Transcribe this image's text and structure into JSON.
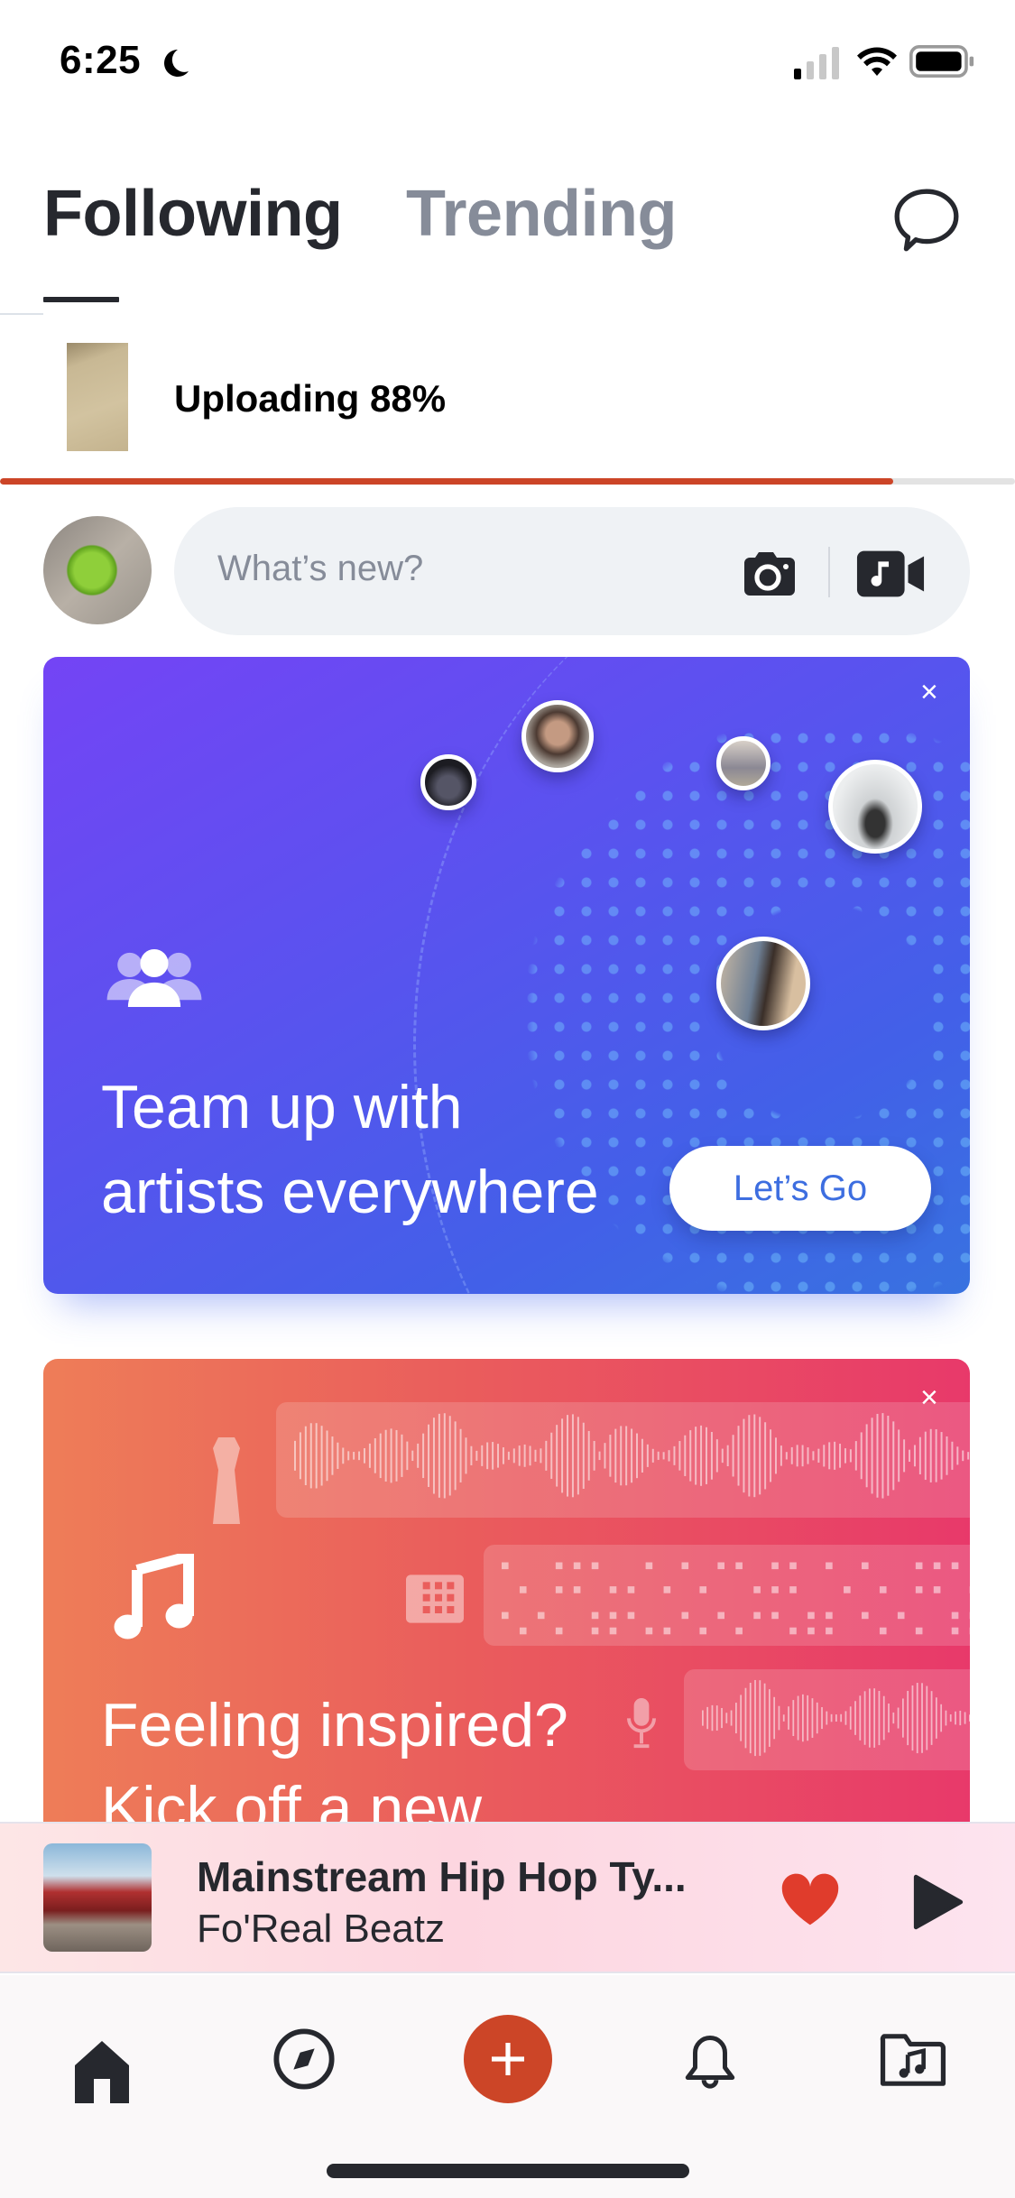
{
  "status_bar": {
    "time": "6:25",
    "focus_icon": "moon-icon",
    "signal_bars_active": 1,
    "signal_bars_total": 4,
    "wifi": "wifi-icon",
    "battery": "battery-icon"
  },
  "header": {
    "tabs": [
      {
        "label": "Following",
        "active": true
      },
      {
        "label": "Trending",
        "active": false
      }
    ],
    "messages_icon": "chat-bubble-icon"
  },
  "upload": {
    "label": "Uploading 88%",
    "progress_percent": 88,
    "progress_color": "#cc4527"
  },
  "composer": {
    "placeholder": "What’s new?",
    "camera_icon": "camera-icon",
    "video_icon": "music-video-icon"
  },
  "cards": [
    {
      "title_line1": "Team up with",
      "title_line2": "artists everywhere",
      "button_label": "Let’s Go",
      "close_label": "×",
      "icon": "team-icon",
      "gradient": [
        "#7444f5",
        "#3872e0"
      ]
    },
    {
      "title_line1": "Feeling inspired?",
      "title_line2": "Kick off a new",
      "close_label": "×",
      "icon": "music-note-icon",
      "instruments": [
        "guitar-icon",
        "drum-machine-icon",
        "microphone-icon"
      ],
      "gradient": [
        "#ee7d58",
        "#e8396a"
      ]
    }
  ],
  "now_playing": {
    "title": "Mainstream Hip Hop Ty...",
    "artist": "Fo'Real Beatz",
    "liked": true,
    "like_color": "#e03c2c",
    "play_icon": "play-icon"
  },
  "tab_bar": {
    "items": [
      {
        "name": "home",
        "icon": "home-icon",
        "active": true
      },
      {
        "name": "discover",
        "icon": "compass-icon",
        "active": false
      },
      {
        "name": "create",
        "icon": "plus-icon",
        "accent": "#cc4527"
      },
      {
        "name": "notifications",
        "icon": "bell-icon",
        "active": false
      },
      {
        "name": "library",
        "icon": "music-folder-icon",
        "active": false
      }
    ]
  }
}
